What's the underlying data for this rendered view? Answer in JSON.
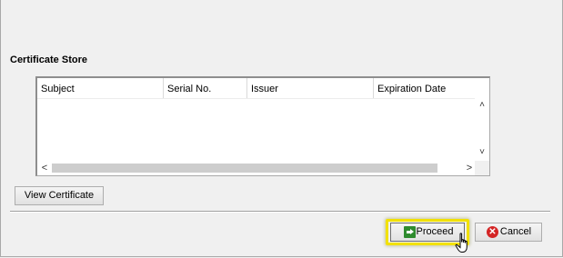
{
  "certificate_store": {
    "title": "Certificate Store",
    "columns": [
      "Subject",
      "Serial No.",
      "Issuer",
      "Expiration Date"
    ],
    "rows": []
  },
  "buttons": {
    "view_certificate": "View Certificate",
    "proceed": "Proceed",
    "cancel": "Cancel"
  },
  "scroll": {
    "up": "˄",
    "down": "˅",
    "left": "<",
    "right": ">"
  },
  "icons": {
    "proceed": "green-arrow-icon",
    "cancel": "red-x-icon",
    "cursor": "hand-pointer-icon"
  },
  "colors": {
    "highlight": "#f2e100",
    "proceed_icon": "#2e8b2e",
    "cancel_icon": "#d42525"
  }
}
